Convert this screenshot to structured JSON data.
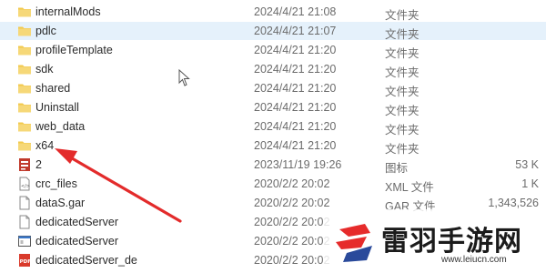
{
  "files": [
    {
      "name": "internalMods",
      "date": "2024/4/21 21:08",
      "type": "文件夹",
      "size": "",
      "icon": "folder-icon"
    },
    {
      "name": "pdlc",
      "date": "2024/4/21 21:07",
      "type": "文件夹",
      "size": "",
      "icon": "folder-icon",
      "selected": true
    },
    {
      "name": "profileTemplate",
      "date": "2024/4/21 21:20",
      "type": "文件夹",
      "size": "",
      "icon": "folder-icon"
    },
    {
      "name": "sdk",
      "date": "2024/4/21 21:20",
      "type": "文件夹",
      "size": "",
      "icon": "folder-icon"
    },
    {
      "name": "shared",
      "date": "2024/4/21 21:20",
      "type": "文件夹",
      "size": "",
      "icon": "folder-icon"
    },
    {
      "name": "Uninstall",
      "date": "2024/4/21 21:20",
      "type": "文件夹",
      "size": "",
      "icon": "folder-icon"
    },
    {
      "name": "web_data",
      "date": "2024/4/21 21:20",
      "type": "文件夹",
      "size": "",
      "icon": "folder-icon"
    },
    {
      "name": "x64",
      "date": "2024/4/21 21:20",
      "type": "文件夹",
      "size": "",
      "icon": "folder-icon"
    },
    {
      "name": "2",
      "date": "2023/11/19 19:26",
      "type": "图标",
      "size": "53 K",
      "icon": "ico-file-icon"
    },
    {
      "name": "crc_files",
      "date": "2020/2/2 20:02",
      "type": "XML 文件",
      "size": "1 K",
      "icon": "xml-file-icon"
    },
    {
      "name": "dataS.gar",
      "date": "2020/2/2 20:02",
      "type": "GAR 文件",
      "size": "1,343,526",
      "icon": "generic-file-icon"
    },
    {
      "name": "dedicatedServer",
      "date": "2020/2/2 20:02",
      "type": "",
      "size": "",
      "icon": "generic-file-icon"
    },
    {
      "name": "dedicatedServer",
      "date": "2020/2/2 20:02",
      "type": "",
      "size": "",
      "icon": "exe-file-icon"
    },
    {
      "name": "dedicatedServer_de",
      "date": "2020/2/2 20:02",
      "type": "",
      "size": "",
      "icon": "pdf-file-icon"
    }
  ],
  "watermark": {
    "title": "雷羽手游网",
    "url": "www.leiucn.com"
  },
  "colors": {
    "selection": "#e5f1fb",
    "folder": "#f2c94c",
    "arrow": "#e32b2b",
    "logo_red": "#e62b2b",
    "logo_blue": "#2a4a9b"
  }
}
